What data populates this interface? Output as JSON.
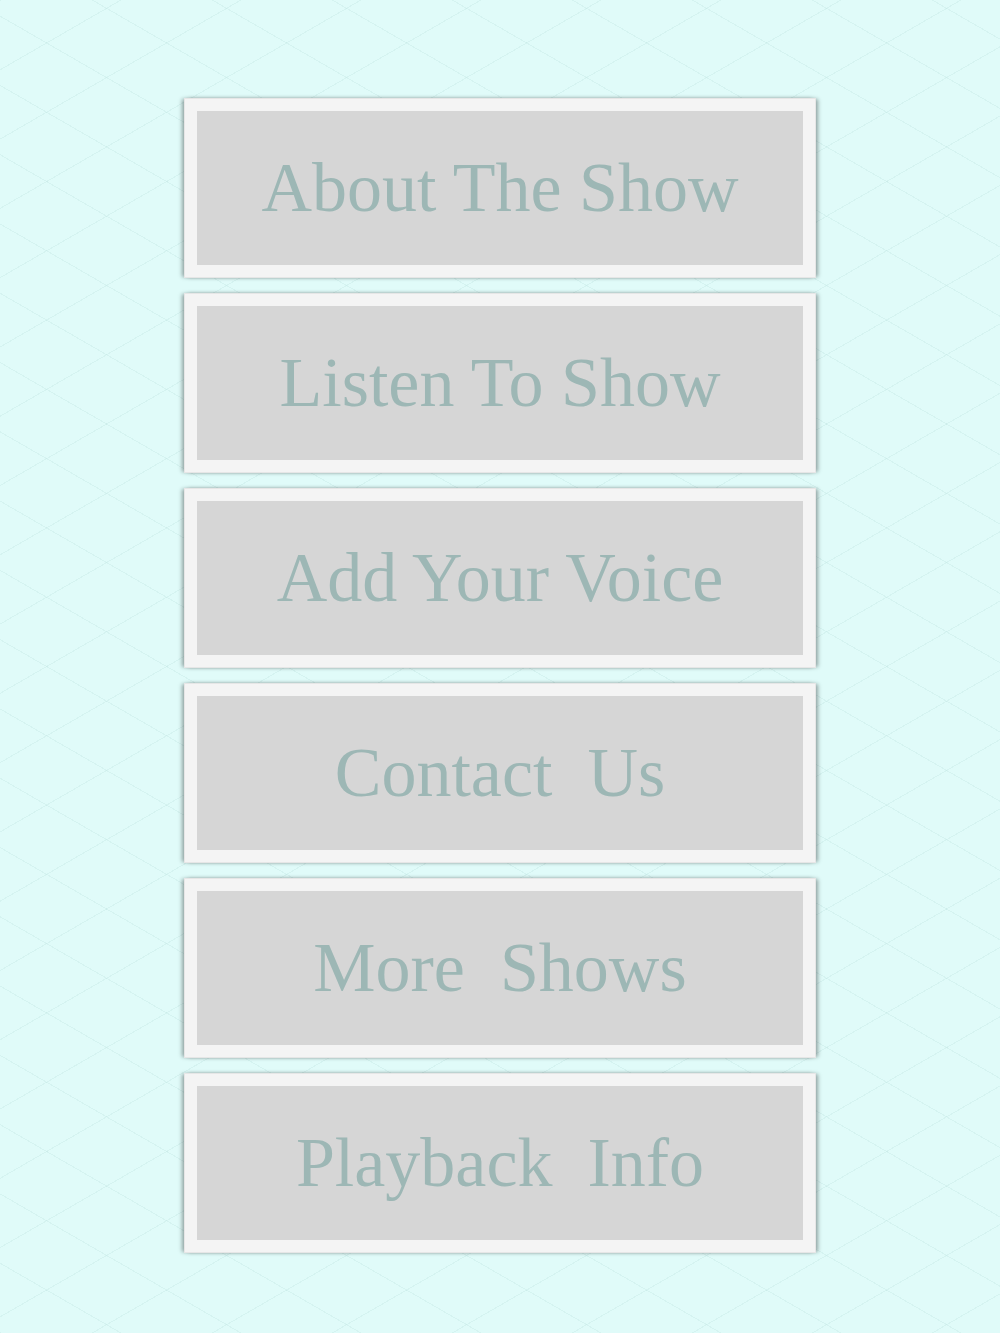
{
  "menu": [
    {
      "label": "About The Show"
    },
    {
      "label": "Listen To Show"
    },
    {
      "label": "Add Your Voice"
    },
    {
      "label": "Contact  Us"
    },
    {
      "label": "More  Shows"
    },
    {
      "label": "Playback  Info"
    }
  ]
}
